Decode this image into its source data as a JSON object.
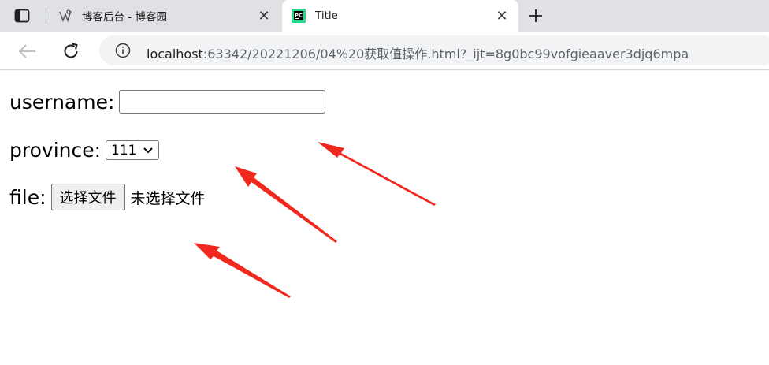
{
  "browser": {
    "tabs": [
      {
        "title": "博客后台 - 博客园",
        "favicon": "cnblogs-favicon",
        "active": false
      },
      {
        "title": "Title",
        "favicon": "pycharm-favicon",
        "active": true
      }
    ],
    "address_bar": {
      "host": "localhost",
      "rest": ":63342/20221206/04%20获取值操作.html?_ijt=8g0bc99vofgieaaver3djq6mpa"
    },
    "icons": [
      "sidebar-icon",
      "back-arrow-icon",
      "reload-icon",
      "info-icon",
      "close-icon",
      "plus-icon"
    ]
  },
  "form": {
    "username_label": "username:",
    "username_value": "",
    "province_label": "province:",
    "province_selected": "111",
    "file_label": "file:",
    "file_button": "选择文件",
    "file_status": "未选择文件"
  },
  "annotations": {
    "arrow_color": "#f0281e",
    "count": 3
  }
}
